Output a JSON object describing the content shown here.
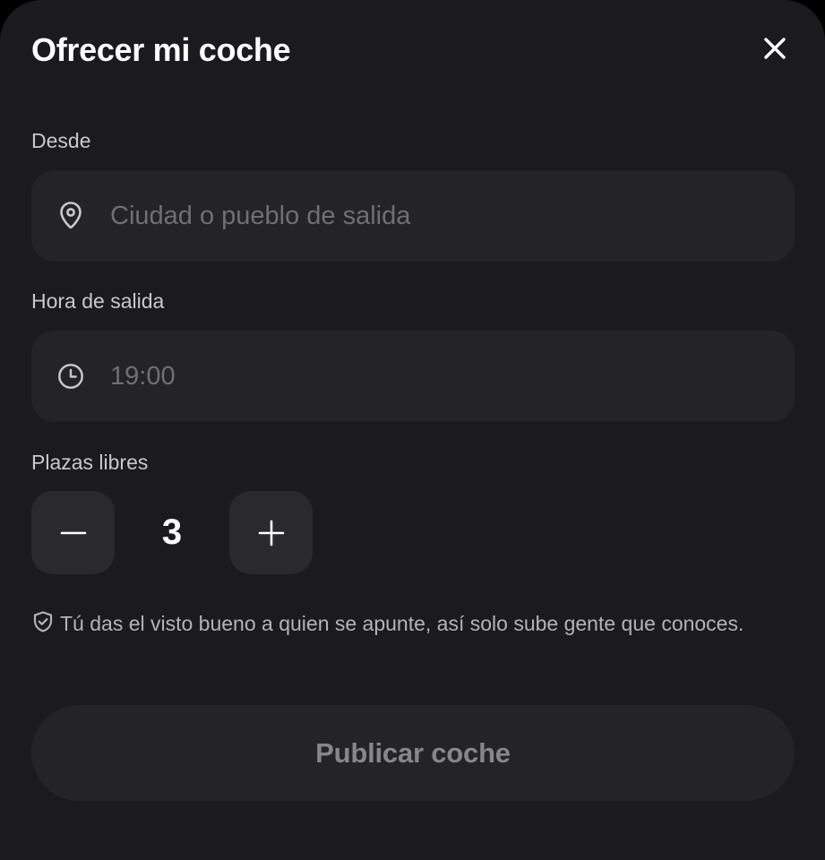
{
  "header": {
    "title": "Ofrecer mi coche",
    "close_icon": "close-icon"
  },
  "from": {
    "label": "Desde",
    "icon": "map-pin-icon",
    "value": "",
    "placeholder": "Ciudad o pueblo de salida"
  },
  "departure": {
    "label": "Hora de salida",
    "icon": "clock-icon",
    "value": "",
    "placeholder": "19:00"
  },
  "seats": {
    "label": "Plazas libres",
    "decrement_icon": "minus-icon",
    "value": "3",
    "increment_icon": "plus-icon"
  },
  "note": {
    "icon": "shield-check-icon",
    "text": "Tú das el visto bueno a quien se apunte, así solo sube gente que conoces."
  },
  "actions": {
    "publish_label": "Publicar coche"
  },
  "colors": {
    "background": "#1b1b1d",
    "surface": "#242427",
    "stepper_surface": "#2a2a2d",
    "text_primary": "#ffffff",
    "text_label": "#c9c9cc",
    "placeholder": "#6f6f74",
    "button_text_disabled": "#86868b"
  }
}
